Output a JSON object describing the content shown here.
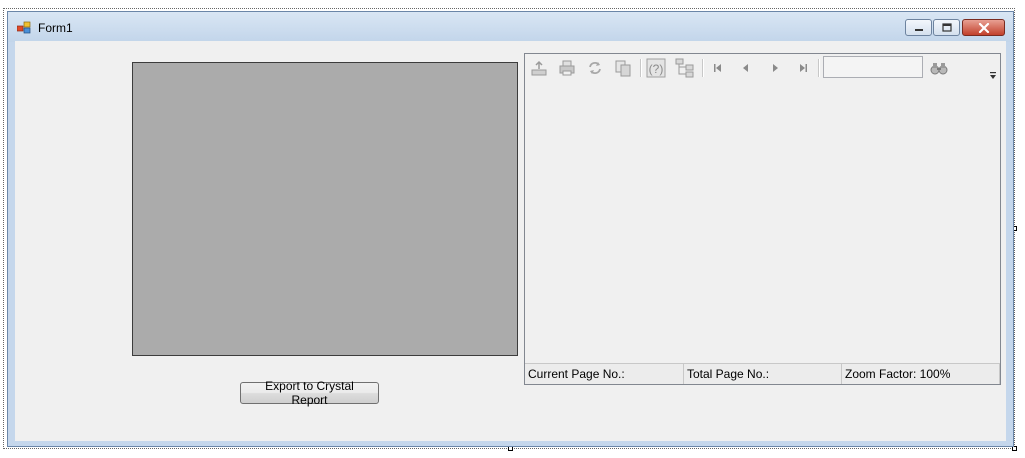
{
  "window": {
    "title": "Form1"
  },
  "export_button": {
    "label": "Export to Crystal Report"
  },
  "report_viewer": {
    "toolbar": {
      "icons": [
        "export-icon",
        "print-icon",
        "refresh-icon",
        "copy-icon",
        "help-icon",
        "group-tree-icon",
        "first-page-icon",
        "previous-page-icon",
        "next-page-icon",
        "last-page-icon",
        "find-icon",
        "overflow-icon"
      ],
      "search_value": ""
    },
    "status": {
      "current_page": "Current Page No.:",
      "total_page": "Total Page No.:",
      "zoom": "Zoom Factor: 100%"
    }
  },
  "colors": {
    "panel": "#ababab",
    "client": "#f0f0f0",
    "close_button": "#c2412c"
  }
}
